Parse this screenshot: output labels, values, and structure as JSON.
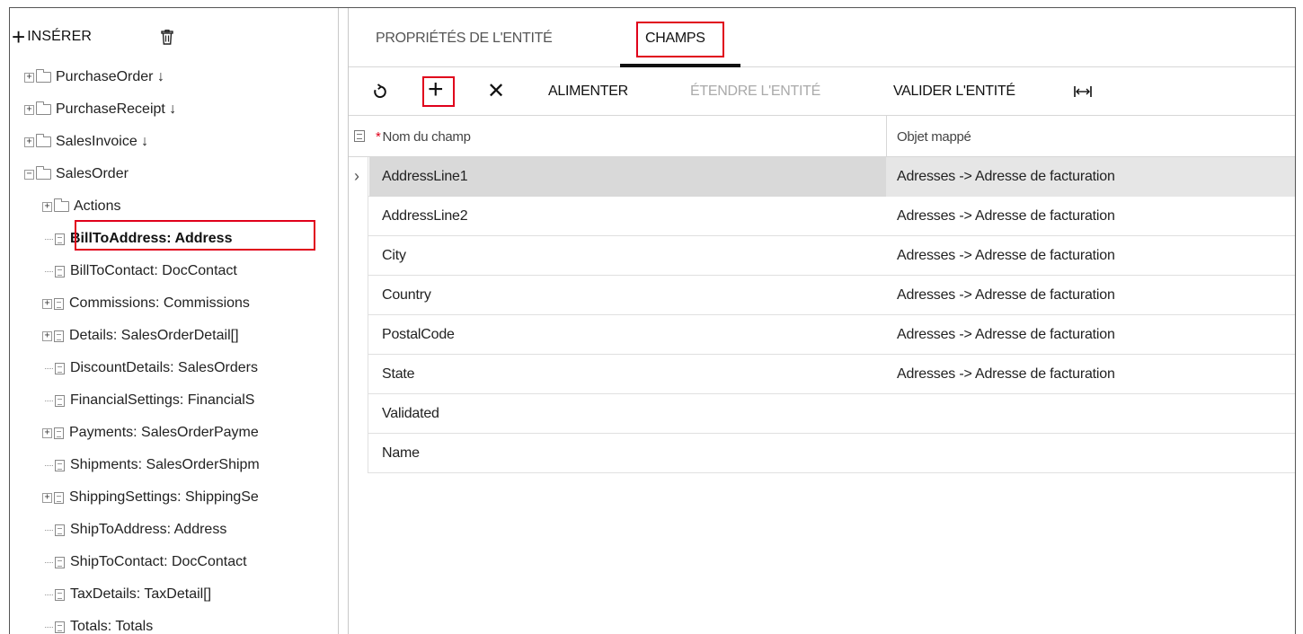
{
  "toolbar_left": {
    "insert_label": "INSÉRER"
  },
  "tree": [
    {
      "label": "PurchaseOrder ↓",
      "type": "folder",
      "indent": 0,
      "expand": "+"
    },
    {
      "label": "PurchaseReceipt ↓",
      "type": "folder",
      "indent": 0,
      "expand": "+"
    },
    {
      "label": "SalesInvoice ↓",
      "type": "folder",
      "indent": 0,
      "expand": "+"
    },
    {
      "label": "SalesOrder",
      "type": "folder",
      "indent": 0,
      "expand": "−"
    },
    {
      "label": "Actions",
      "type": "folder",
      "indent": 1,
      "expand": "+"
    },
    {
      "label": "BillToAddress: Address",
      "type": "doc",
      "indent": 1,
      "expand": "",
      "selected": true
    },
    {
      "label": "BillToContact: DocContact",
      "type": "doc",
      "indent": 1,
      "expand": ""
    },
    {
      "label": "Commissions: Commissions",
      "type": "doc",
      "indent": 1,
      "expand": "+"
    },
    {
      "label": "Details: SalesOrderDetail[]",
      "type": "doc",
      "indent": 1,
      "expand": "+"
    },
    {
      "label": "DiscountDetails: SalesOrders",
      "type": "doc",
      "indent": 1,
      "expand": ""
    },
    {
      "label": "FinancialSettings: FinancialS",
      "type": "doc",
      "indent": 1,
      "expand": ""
    },
    {
      "label": "Payments: SalesOrderPayme",
      "type": "doc",
      "indent": 1,
      "expand": "+"
    },
    {
      "label": "Shipments: SalesOrderShipm",
      "type": "doc",
      "indent": 1,
      "expand": ""
    },
    {
      "label": "ShippingSettings: ShippingSe",
      "type": "doc",
      "indent": 1,
      "expand": "+"
    },
    {
      "label": "ShipToAddress: Address",
      "type": "doc",
      "indent": 1,
      "expand": ""
    },
    {
      "label": "ShipToContact: DocContact",
      "type": "doc",
      "indent": 1,
      "expand": ""
    },
    {
      "label": "TaxDetails: TaxDetail[]",
      "type": "doc",
      "indent": 1,
      "expand": ""
    },
    {
      "label": "Totals: Totals",
      "type": "doc",
      "indent": 1,
      "expand": ""
    }
  ],
  "tabs": {
    "properties": "PROPRIÉTÉS DE L'ENTITÉ",
    "fields": "CHAMPS"
  },
  "toolbar": {
    "feed": "ALIMENTER",
    "extend": "ÉTENDRE L'ENTITÉ",
    "validate": "VALIDER L'ENTITÉ"
  },
  "grid": {
    "headers": {
      "required_mark": "*",
      "field_name": "Nom du champ",
      "mapped_object": "Objet mappé"
    },
    "rows": [
      {
        "field": "AddressLine1",
        "mapped": "Adresses -> Adresse de facturation",
        "active": true
      },
      {
        "field": "AddressLine2",
        "mapped": "Adresses -> Adresse de facturation"
      },
      {
        "field": "City",
        "mapped": "Adresses -> Adresse de facturation"
      },
      {
        "field": "Country",
        "mapped": "Adresses -> Adresse de facturation"
      },
      {
        "field": "PostalCode",
        "mapped": "Adresses -> Adresse de facturation"
      },
      {
        "field": "State",
        "mapped": "Adresses -> Adresse de facturation"
      },
      {
        "field": "Validated",
        "mapped": ""
      },
      {
        "field": "Name",
        "mapped": ""
      }
    ]
  },
  "colors": {
    "highlight": "#e0001b",
    "active_row": "#d9d9d9"
  }
}
